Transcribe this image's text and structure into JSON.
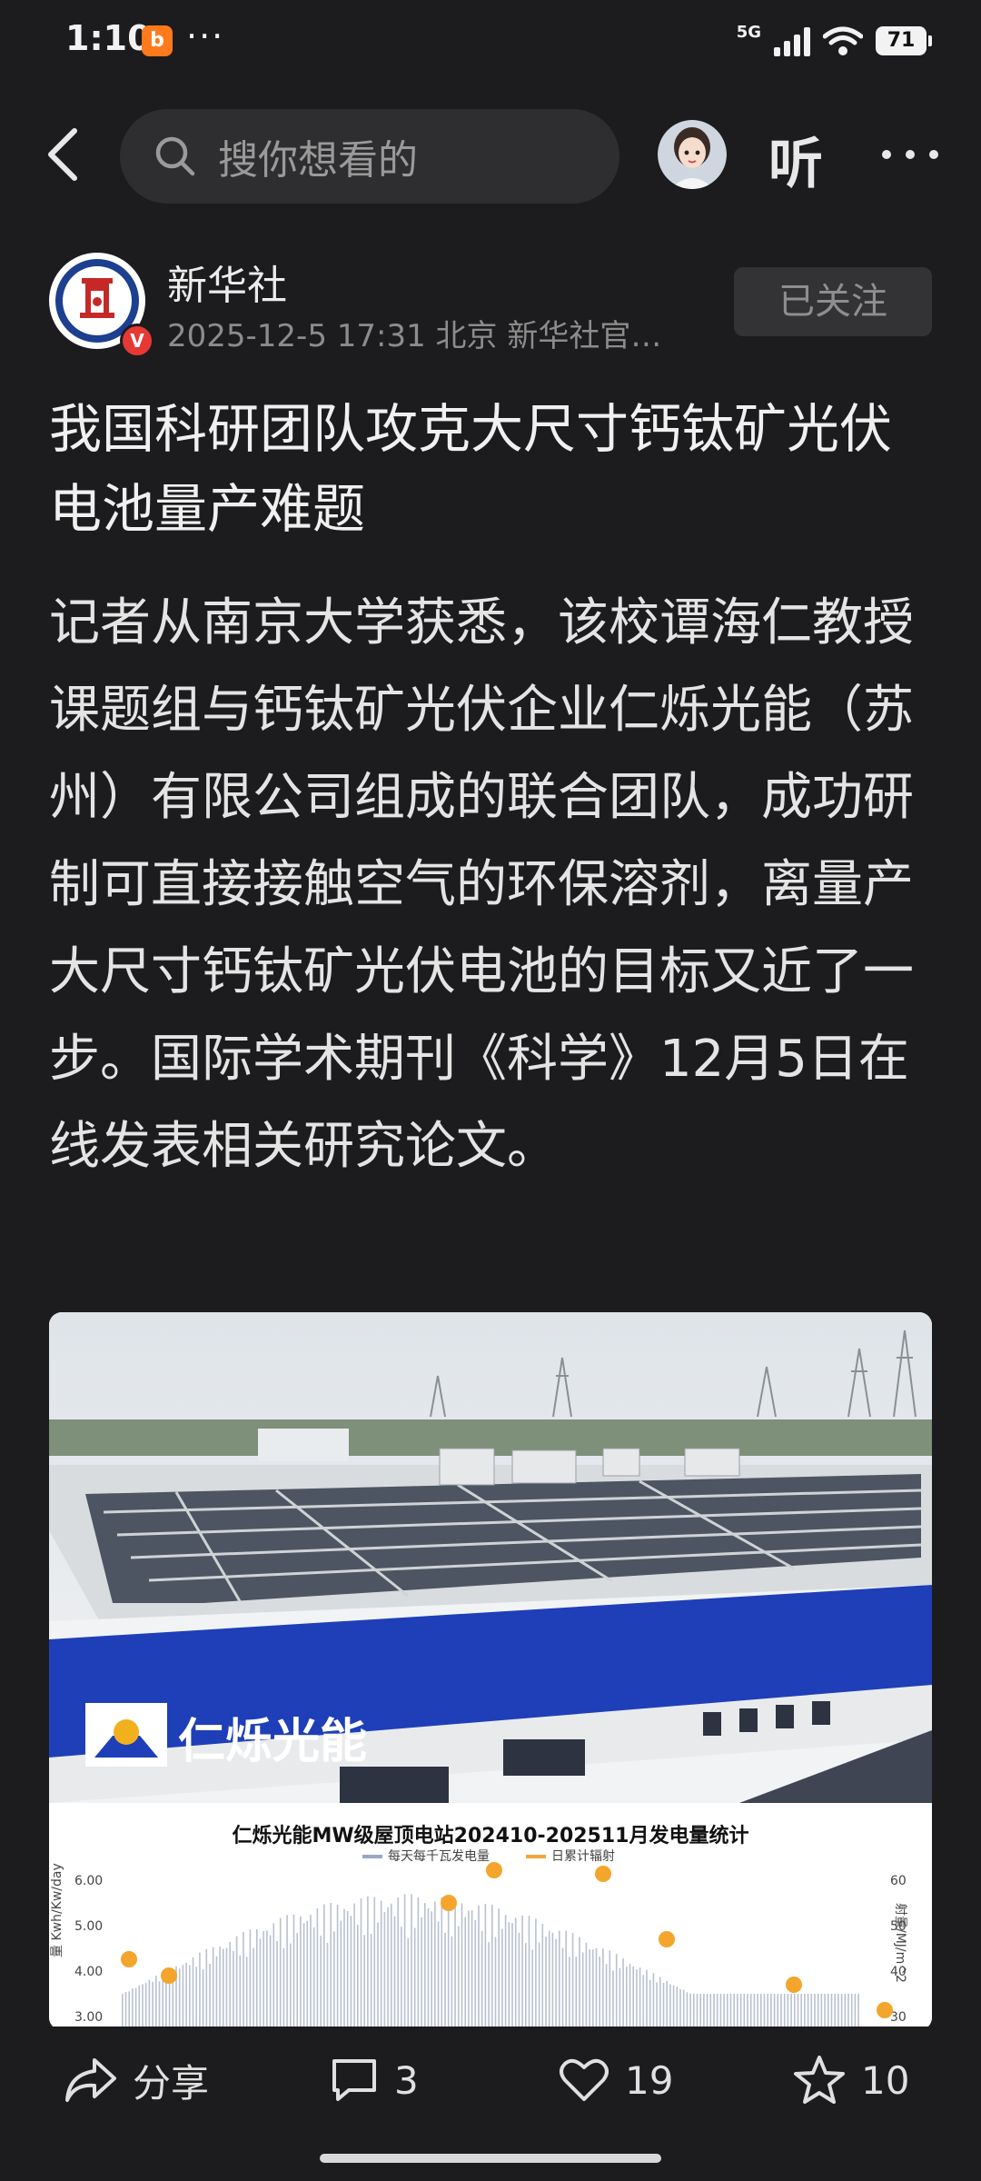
{
  "status_bar": {
    "time": "1:10",
    "app_badge": "b",
    "more_dots": "···",
    "network": "5G",
    "battery": "71"
  },
  "nav": {
    "search_placeholder": "搜你想看的",
    "listen_label": "听"
  },
  "author": {
    "name": "新华社",
    "meta": "2025-12-5  17:31  北京  新华社官…",
    "verified_badge": "V",
    "follow_label": "已关注"
  },
  "article": {
    "title": "我国科研团队攻克大尺寸钙钛矿光伏电池量产难题",
    "body": "记者从南京大学获悉，该校谭海仁教授课题组与钙钛矿光伏企业仁烁光能（苏州）有限公司组成的联合团队，成功研制可直接接触空气的环保溶剂，离量产大尺寸钙钛矿光伏电池的目标又近了一步。国际学术期刊《科学》12月5日在线发表相关研究论文。"
  },
  "image": {
    "building_sign": "仁烁光能",
    "chart_title": "仁烁光能MW级屋顶电站202410-202511月发电量统计",
    "legend_bar": "每天每千瓦发电量",
    "legend_line": "日累计辐射",
    "ylabel_left": "量 Kwh/Kw/day",
    "ylabel_right": "射量/MJ/m^2",
    "left_ticks": [
      "6.00",
      "5.00",
      "4.00",
      "3.00"
    ],
    "right_ticks": [
      "60",
      "50",
      "40",
      "30"
    ]
  },
  "actions": {
    "share_label": "分享",
    "comment_count": "3",
    "like_count": "19",
    "favorite_count": "10"
  },
  "colors": {
    "background": "#1c1c1e",
    "search_bg": "#2e2e30",
    "follow_bg": "#333335",
    "building_blue": "#1e3fb8"
  }
}
